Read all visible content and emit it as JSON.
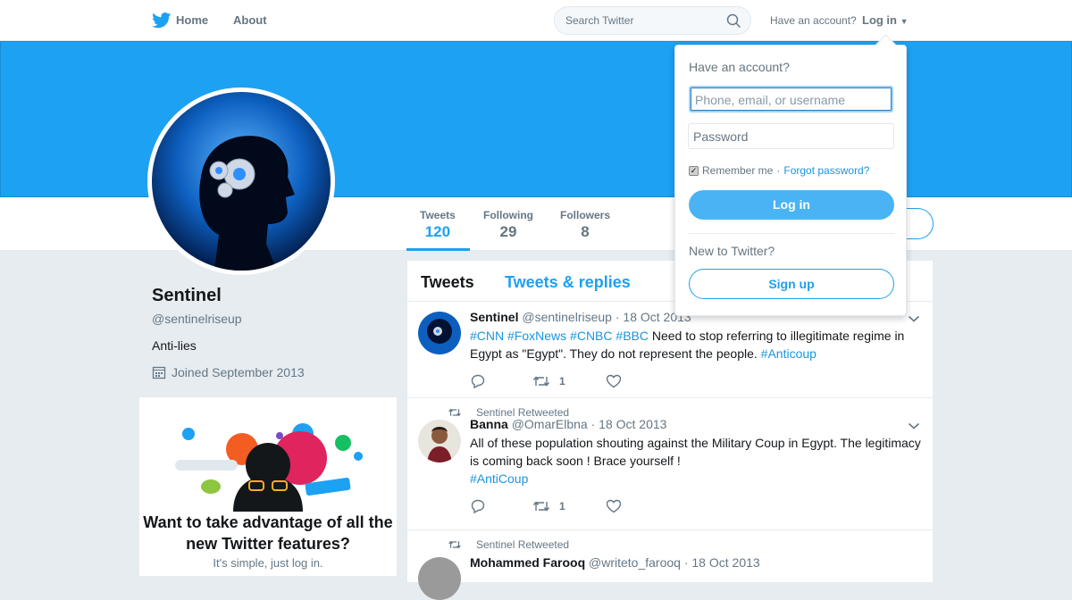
{
  "topbar": {
    "home_label": "Home",
    "about_label": "About",
    "search_placeholder": "Search Twitter",
    "have_account": "Have an account?",
    "login_label": "Log in"
  },
  "profile": {
    "name": "Sentinel",
    "handle": "@sentinelriseup",
    "bio": "Anti-lies",
    "joined": "Joined September 2013"
  },
  "stats": [
    {
      "label": "Tweets",
      "value": "120"
    },
    {
      "label": "Following",
      "value": "29"
    },
    {
      "label": "Followers",
      "value": "8"
    }
  ],
  "promo": {
    "title": "Want to take advantage of all the new Twitter features?",
    "subtitle": "It's simple, just log in."
  },
  "timeline": {
    "tabs": [
      "Tweets",
      "Tweets & replies"
    ],
    "tweets": [
      {
        "retweet_line": "",
        "name": "Sentinel",
        "handle": "@sentinelriseup",
        "date": "· 18 Oct 2013",
        "hashtags_lead": [
          "#CNN",
          "#FoxNews",
          "#CNBC",
          "#BBC"
        ],
        "text": "Need to stop referring to illegitimate regime in Egypt as \"Egypt\".  They do not represent the people.",
        "hashtag_tail": "#Anticoup",
        "retweets": "1"
      },
      {
        "retweet_line": "Sentinel Retweeted",
        "name": "Banna",
        "handle": "@OmarElbna",
        "date": "· 18 Oct 2013",
        "text": "All of these population shouting against the Military Coup in Egypt. The legitimacy is coming back soon ! Brace yourself !",
        "hashtag_tail": "#AntiCoup",
        "retweets": "1"
      },
      {
        "retweet_line": "Sentinel Retweeted",
        "name": "Mohammed Farooq",
        "handle": "@writeto_farooq",
        "date": "· 18 Oct 2013"
      }
    ]
  },
  "login_dropdown": {
    "title": "Have an account?",
    "username_placeholder": "Phone, email, or username",
    "password_placeholder": "Password",
    "remember_label": "Remember me",
    "separator": "·",
    "forgot_label": "Forgot password?",
    "login_button": "Log in",
    "new_label": "New to Twitter?",
    "signup_button": "Sign up"
  },
  "colors": {
    "accent": "#1da1f2",
    "banner": "#1da1f2",
    "link": "#1b95e0"
  }
}
